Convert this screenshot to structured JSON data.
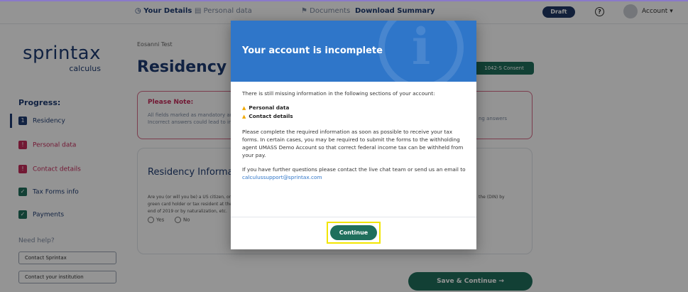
{
  "topbar": {
    "steps": [
      {
        "label": "◷ Your Details",
        "active": true
      },
      {
        "label": "▤ Personal data",
        "active": false
      },
      {
        "label": "⚑ Documents",
        "active": false
      },
      {
        "label": "Download Summary",
        "active": false
      }
    ],
    "badge": "Draft",
    "help_label": "?",
    "account_label": "Account ▾"
  },
  "sidebar": {
    "logo_word": "sprintax",
    "logo_sub": "calculus",
    "progress_title": "Progress:",
    "items": [
      {
        "label": "Residency",
        "status": "current",
        "box": "1",
        "color": "#1e3c72"
      },
      {
        "label": "Personal data",
        "status": "incomplete",
        "box": "!",
        "color": "#c52b5b"
      },
      {
        "label": "Contact details",
        "status": "incomplete",
        "box": "!",
        "color": "#c52b5b"
      },
      {
        "label": "Tax Forms info",
        "status": "done",
        "box": "✓",
        "color": "#1f6f5c"
      },
      {
        "label": "Payments",
        "status": "done",
        "box": "✓",
        "color": "#1f6f5c"
      }
    ],
    "need_help": "Need help?",
    "contact_sprintax": "Contact Sprintax",
    "contact_institution": "Contact your institution"
  },
  "main": {
    "student_name": "Eosanni Test",
    "title": "Residency",
    "consent_button": "1042-S Consent",
    "note_title": "Please Note:",
    "note_text": "All fields marked as mandatory are required. Incorrect answers could lead to incorrect",
    "note_right": "ng answers",
    "section_title": "Residency Information",
    "question": "Are you (or will you be) a US citizen, or US green card holder or tax resident at the end of 2019 or by naturalization, etc.",
    "question_right": "the (DIN) by",
    "radio_yes": "Yes",
    "radio_no": "No",
    "save_continue": "Save & Continue →"
  },
  "modal": {
    "title": "Your account is incomplete",
    "intro": "There is still missing information in the following sections of your account:",
    "missing_items": [
      "Personal data",
      "Contact details"
    ],
    "paragraph": "Please complete the required information as soon as possible to receive your tax forms. In certain cases, you may be required to submit the forms to the withholding agent UMASS Demo Account so that correct federal income tax can be withheld from your pay.",
    "contact_prefix": "If you have further questions please contact the live chat team or send us an email to ",
    "contact_email": "calculussupport@sprintax.com",
    "continue_label": "Continue",
    "header_color": "#2f76c9",
    "button_color": "#1f6f5c",
    "highlight_color": "#f2e500"
  }
}
